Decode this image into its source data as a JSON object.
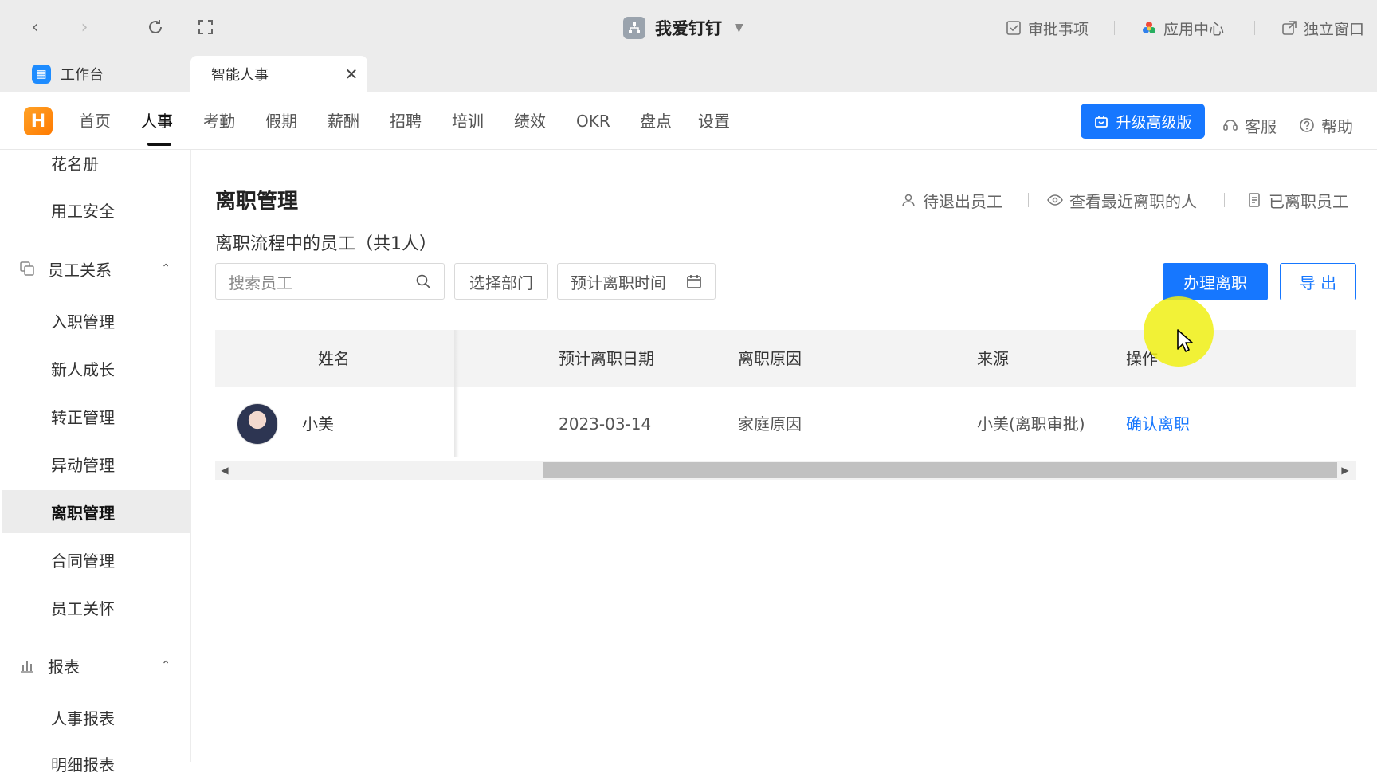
{
  "topbar": {
    "org_name": "我爱钉钉",
    "actions": {
      "approval": "审批事项",
      "app_center": "应用中心",
      "standalone": "独立窗口"
    },
    "tabs": {
      "workbench": "工作台",
      "hr": "智能人事"
    }
  },
  "header": {
    "logo_letter": "H",
    "nav": [
      "首页",
      "人事",
      "考勤",
      "假期",
      "薪酬",
      "招聘",
      "培训",
      "绩效",
      "OKR",
      "盘点",
      "设置"
    ],
    "active_nav": "人事",
    "upgrade_label": "升级高级版",
    "service_label": "客服",
    "help_label": "帮助"
  },
  "sidebar": {
    "items_top": [
      "花名册",
      "用工安全"
    ],
    "group_relations": "员工关系",
    "relations_items": [
      "入职管理",
      "新人成长",
      "转正管理",
      "异动管理",
      "离职管理",
      "合同管理",
      "员工关怀"
    ],
    "active_item": "离职管理",
    "group_reports": "报表",
    "reports_items": [
      "人事报表",
      "明细报表"
    ]
  },
  "main": {
    "title": "离职管理",
    "quick_links": {
      "pending": "待退出员工",
      "recent": "查看最近离职的人",
      "left": "已离职员工"
    },
    "subtitle": "离职流程中的员工（共1人）",
    "filters": {
      "search_placeholder": "搜索员工",
      "dept_label": "选择部门",
      "date_label": "预计离职时间"
    },
    "primary_button": "办理离职",
    "export_button": "导 出",
    "table": {
      "columns": {
        "name": "姓名",
        "date": "预计离职日期",
        "reason": "离职原因",
        "source": "来源",
        "action": "操作"
      },
      "rows": [
        {
          "name": "小美",
          "date": "2023-03-14",
          "reason": "家庭原因",
          "source": "小美(离职审批)",
          "action": "确认离职"
        }
      ]
    }
  },
  "colors": {
    "primary": "#1677ff",
    "logo_orange": "#ff8a00",
    "cursor_highlight": "#f0f014"
  }
}
